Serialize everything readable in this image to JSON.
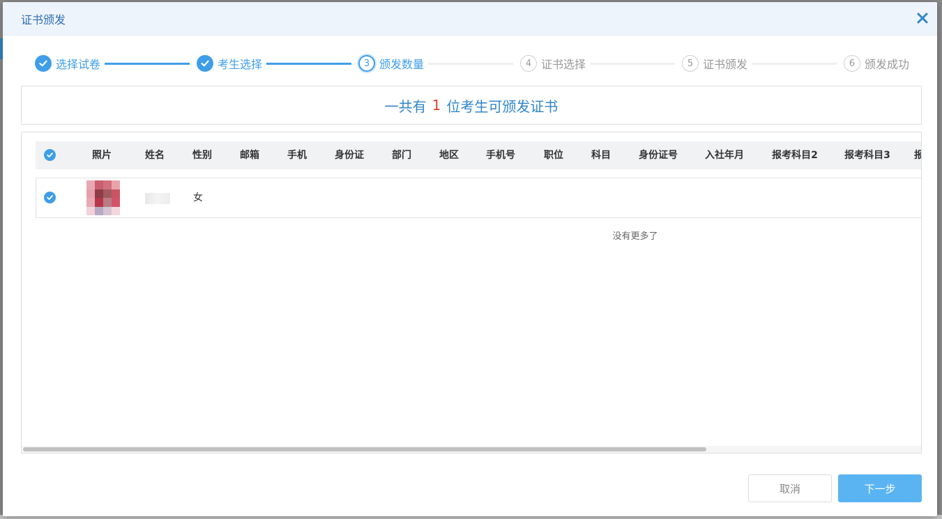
{
  "dialog": {
    "title": "证书颁发",
    "close_icon": "close-icon"
  },
  "steps": [
    {
      "num": "1",
      "label": "选择试卷",
      "state": "done"
    },
    {
      "num": "2",
      "label": "考生选择",
      "state": "done"
    },
    {
      "num": "3",
      "label": "颁发数量",
      "state": "active"
    },
    {
      "num": "4",
      "label": "证书选择",
      "state": "todo"
    },
    {
      "num": "5",
      "label": "证书颁发",
      "state": "todo"
    },
    {
      "num": "6",
      "label": "颁发成功",
      "state": "todo"
    }
  ],
  "summary": {
    "prefix": "一共有",
    "count": "1",
    "suffix": "位考生可颁发证书"
  },
  "table": {
    "columns": [
      "照片",
      "姓名",
      "性别",
      "邮箱",
      "手机",
      "身份证",
      "部门",
      "地区",
      "手机号",
      "职位",
      "科目",
      "身份证号",
      "入社年月",
      "报考科目2",
      "报考科目3",
      "报"
    ],
    "rows": [
      {
        "selected": true,
        "photo": "blurred-photo",
        "name": "",
        "gender": "女"
      }
    ],
    "footer_text": "没有更多了"
  },
  "footer": {
    "cancel_label": "取消",
    "next_label": "下一步"
  },
  "colors": {
    "accent": "#3f9ee8",
    "count_highlight": "#e0412f",
    "next_button": "#5ab4f2"
  }
}
